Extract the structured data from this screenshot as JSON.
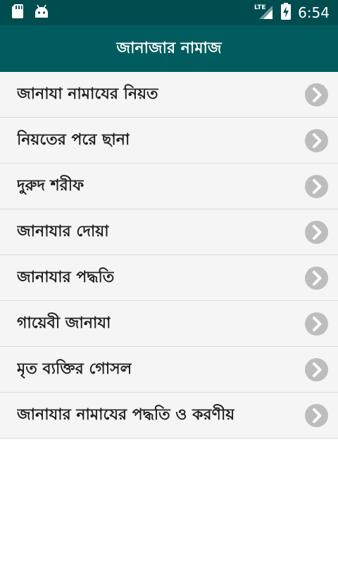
{
  "status_bar": {
    "time": "6:54",
    "network": "LTE",
    "icons": [
      "sd-card-icon",
      "android-icon",
      "signal-icon",
      "battery-charging-icon"
    ]
  },
  "app_bar": {
    "title": "জানাজার নামাজ"
  },
  "list": {
    "items": [
      {
        "label": "জানাযা নামাযের নিয়ত"
      },
      {
        "label": "নিয়তের পরে ছানা"
      },
      {
        "label": "দুরুদ শরীফ"
      },
      {
        "label": "জানাযার দোয়া"
      },
      {
        "label": "জানাযার পদ্ধতি"
      },
      {
        "label": "গায়েবী জানাযা"
      },
      {
        "label": "মৃত ব্যক্তির গোসল"
      },
      {
        "label": "জানাযার নামাযের পদ্ধতি ও করণীয়"
      }
    ]
  },
  "colors": {
    "status_bar": "#004d4f",
    "app_bar": "#005c5e",
    "list_bg": "#f5f5f5",
    "chevron": "#bdbdbd"
  }
}
